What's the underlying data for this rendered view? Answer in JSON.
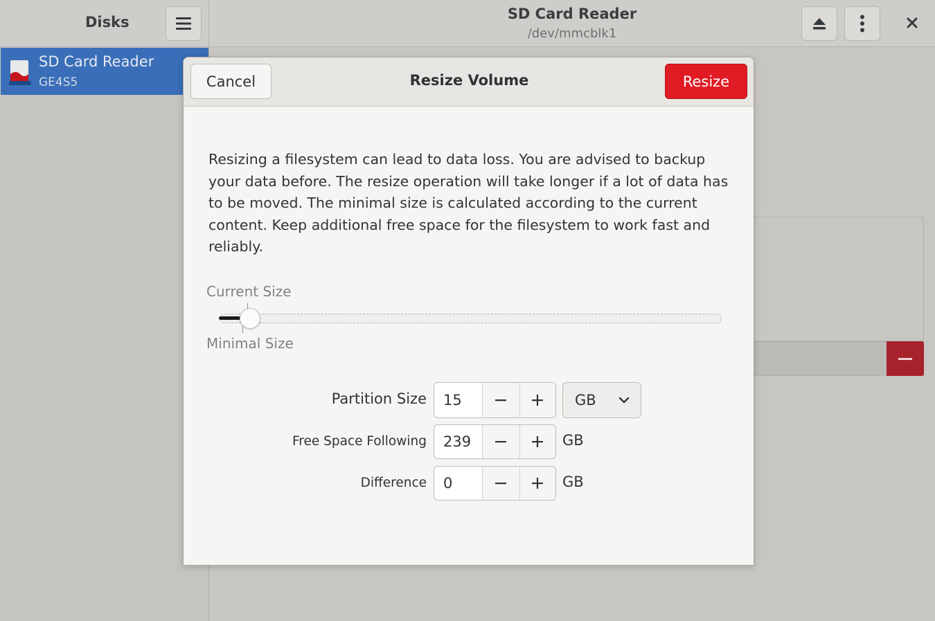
{
  "sidebar": {
    "title": "Disks",
    "menu_icon": "hamburger-menu-icon",
    "disks": [
      {
        "name": "SD Card Reader",
        "model": "GE4S5",
        "icon": "sd-card-icon",
        "selected": true
      }
    ]
  },
  "header": {
    "title": "SD Card Reader",
    "subtitle": "/dev/mmcblk1",
    "eject_icon": "eject-icon",
    "more_icon": "vertical-ellipsis-icon",
    "close_icon": "close-icon"
  },
  "dialog": {
    "title": "Resize Volume",
    "cancel_label": "Cancel",
    "resize_label": "Resize",
    "warning": "Resizing a filesystem can lead to data loss. You are advised to backup your data before. The resize operation will take longer if a lot of data has to be moved. The minimal size is calculated according to the current content. Keep additional free space for the filesystem to work fast and reliably.",
    "slider": {
      "current_label": "Current Size",
      "minimal_label": "Minimal Size",
      "value_fraction": 0.06
    },
    "fields": [
      {
        "label": "Partition Size",
        "value": "15",
        "unit": "GB",
        "unit_is_select": true
      },
      {
        "label": "Free Space Following",
        "value": "239",
        "unit": "GB",
        "unit_is_select": false
      },
      {
        "label": "Difference",
        "value": "0",
        "unit": "GB",
        "unit_is_select": false
      }
    ]
  },
  "background": {
    "delete_partition_icon": "minus-icon"
  },
  "colors": {
    "accent_destructive": "#e01b24",
    "selection_blue": "#3a6eb8"
  }
}
